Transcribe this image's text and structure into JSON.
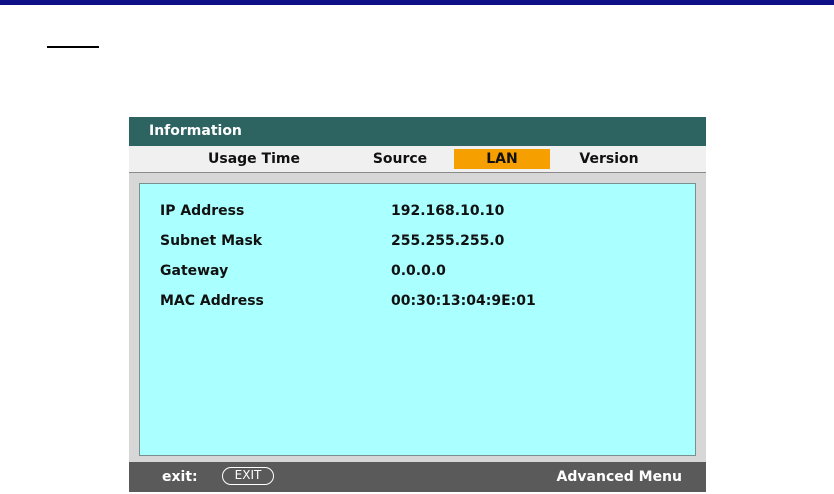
{
  "window": {
    "title": "Information"
  },
  "tabs": [
    {
      "label": "Usage Time",
      "active": false
    },
    {
      "label": "Source",
      "active": false
    },
    {
      "label": "LAN",
      "active": true
    },
    {
      "label": "Version",
      "active": false
    }
  ],
  "lan": {
    "rows": [
      {
        "label": "IP Address",
        "value": "192.168.10.10"
      },
      {
        "label": "Subnet Mask",
        "value": "255.255.255.0"
      },
      {
        "label": "Gateway",
        "value": "0.0.0.0"
      },
      {
        "label": "MAC Address",
        "value": "00:30:13:04:9E:01"
      }
    ]
  },
  "footer": {
    "exit_label": "exit:",
    "exit_key": "EXIT",
    "advanced_menu": "Advanced Menu"
  },
  "colors": {
    "title_bar": "#2d6461",
    "active_tab": "#f5a000",
    "content_bg": "#aaffff",
    "footer_bg": "#5a5a5a",
    "top_bar": "#0f0f87"
  }
}
